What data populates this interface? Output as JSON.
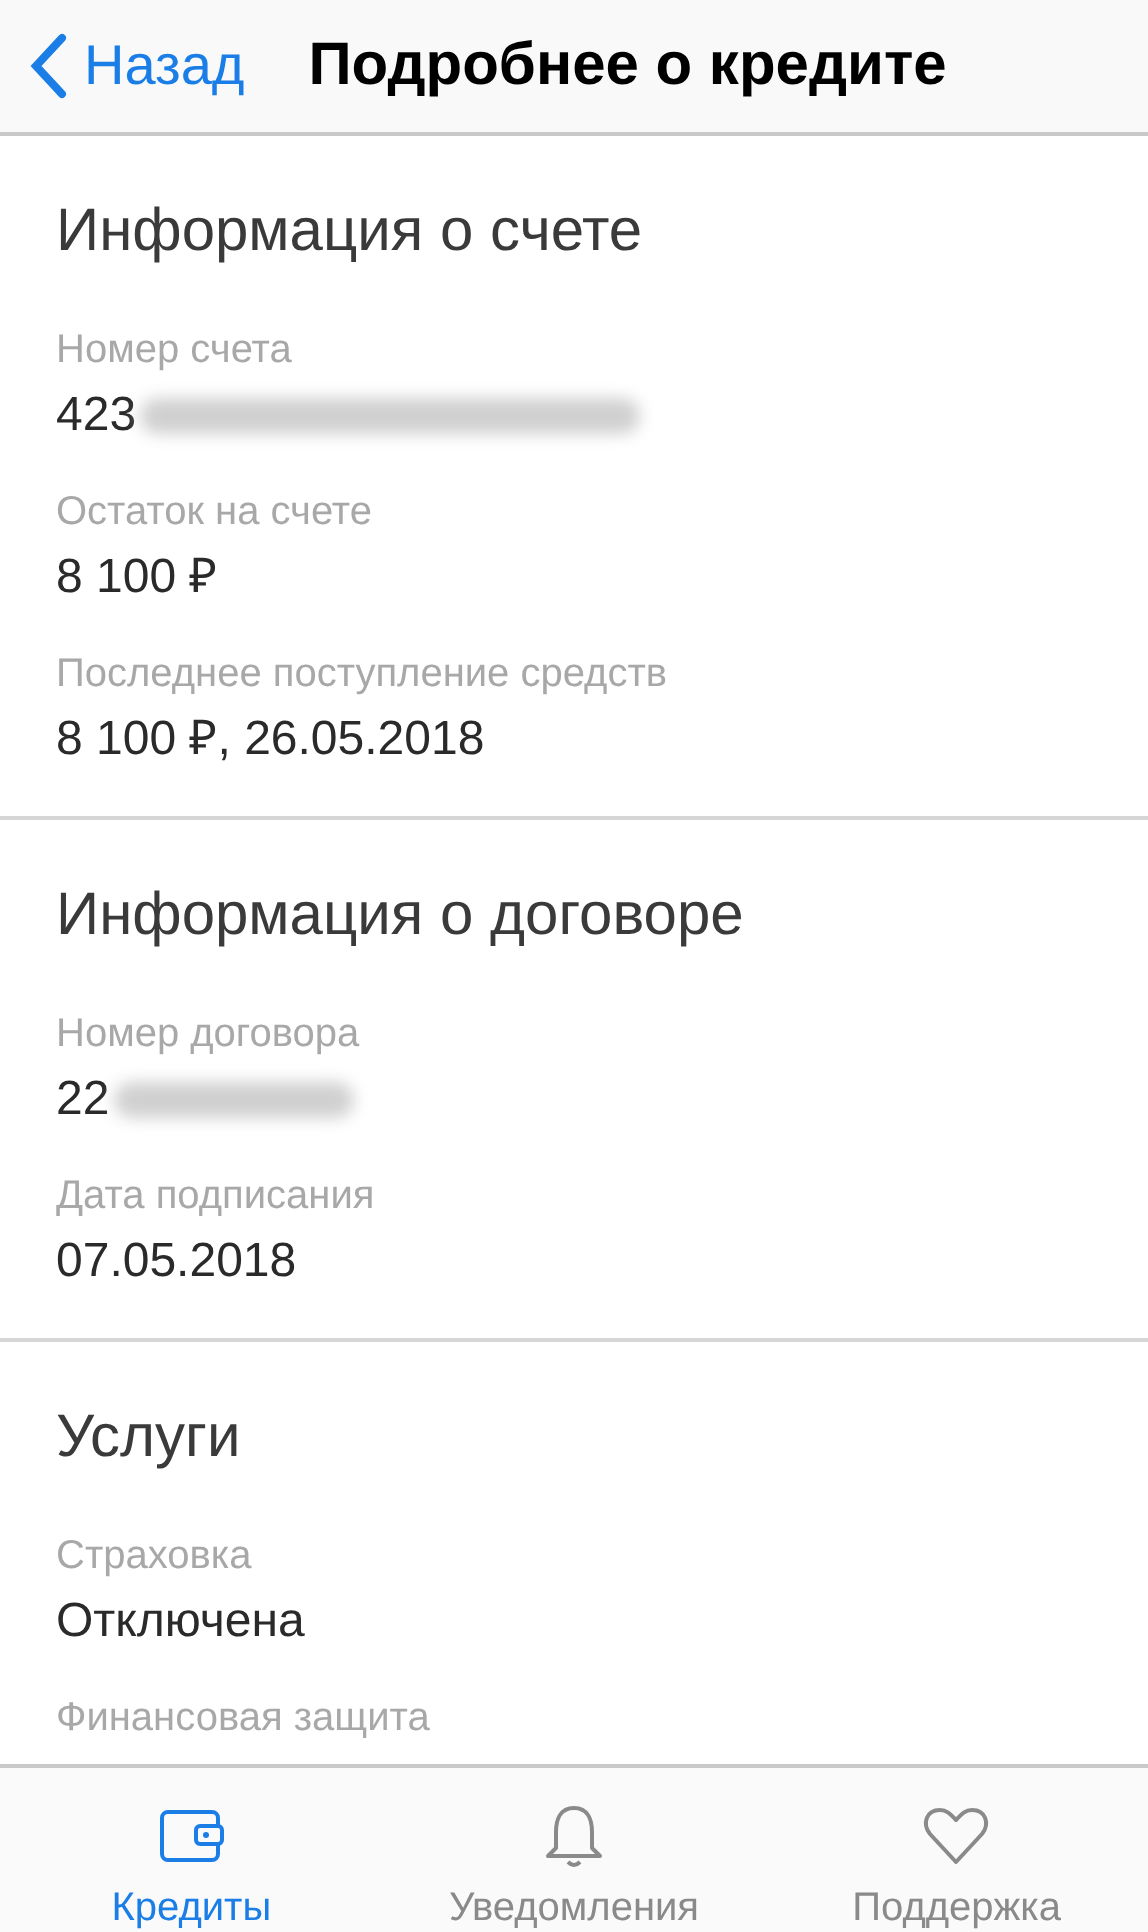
{
  "nav_bar": {
    "back": "Назад",
    "title": "Подробнее о кредите"
  },
  "sections": [
    {
      "title": "Информация о счете",
      "fields": [
        {
          "label": "Номер счета",
          "value": "423",
          "redacted": true
        },
        {
          "label": "Остаток на счете",
          "value": "8 100 ₽",
          "redacted": false
        },
        {
          "label": "Последнее поступление средств",
          "value": "8 100 ₽, 26.05.2018",
          "redacted": false
        }
      ]
    },
    {
      "title": "Информация о договоре",
      "fields": [
        {
          "label": "Номер договора",
          "value": "22",
          "redacted": true
        },
        {
          "label": "Дата подписания",
          "value": "07.05.2018",
          "redacted": false
        }
      ]
    },
    {
      "title": "Услуги",
      "fields": [
        {
          "label": "Страховка",
          "value": "Отключена",
          "redacted": false
        },
        {
          "label": "Финансовая защита"
        }
      ]
    }
  ],
  "tab_bar": [
    {
      "kind": "wallet",
      "label": "Кредиты",
      "selected": true
    },
    {
      "kind": "bell",
      "label": "Уведомления",
      "selected": false
    },
    {
      "kind": "heart",
      "label": "Поддержка",
      "selected": false
    }
  ]
}
